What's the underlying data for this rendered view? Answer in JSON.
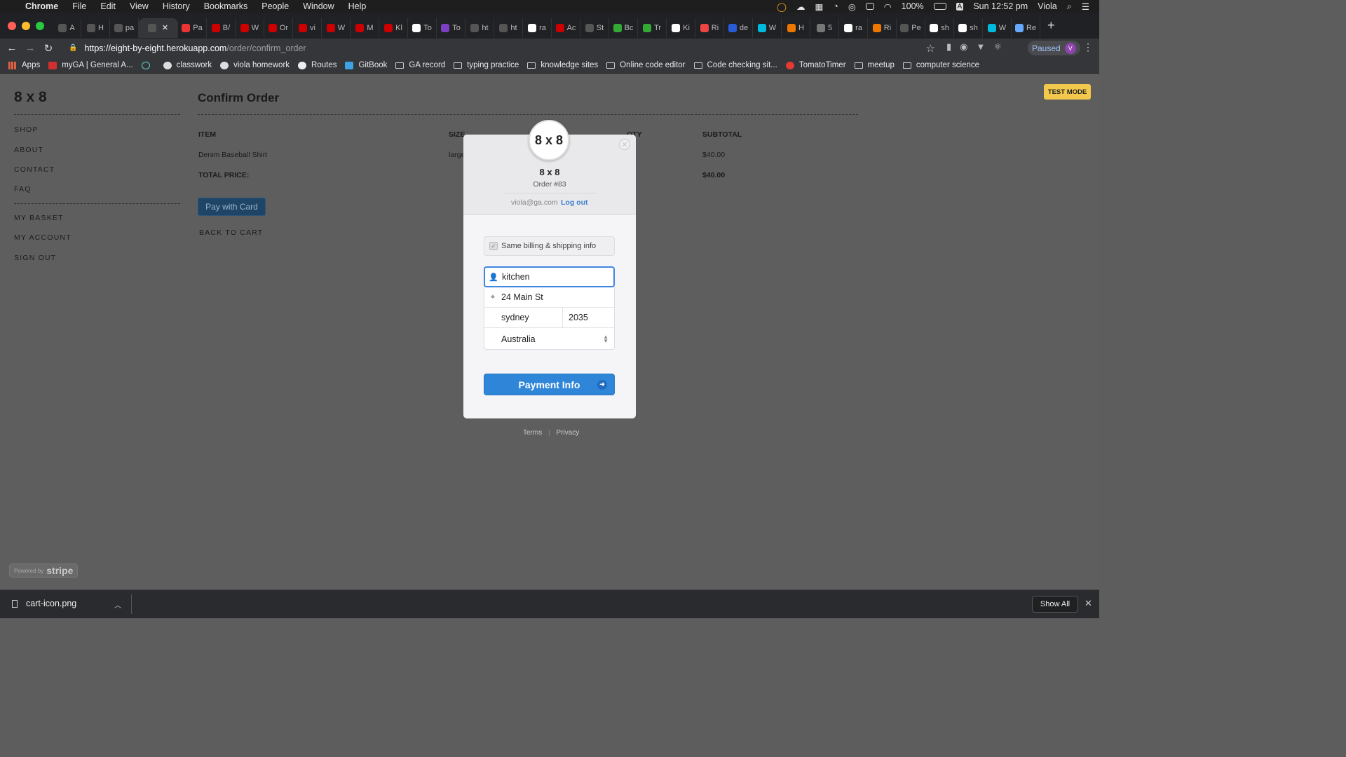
{
  "menubar": {
    "app": "Chrome",
    "items": [
      "File",
      "Edit",
      "View",
      "History",
      "Bookmarks",
      "People",
      "Window",
      "Help"
    ],
    "battery": "100%",
    "clock": "Sun 12:52 pm",
    "user": "Viola"
  },
  "tabs": [
    "A",
    "H",
    "pa",
    "",
    "Pa",
    "B/",
    "W",
    "Or",
    "vi",
    "W",
    "M",
    "Kl",
    "To",
    "To",
    "ht",
    "ht",
    "ra",
    "Ac",
    "St",
    "Bc",
    "Tr",
    "Ki",
    "Ri",
    "de",
    "W",
    "H",
    "5",
    "ra",
    "Ri",
    "Pe",
    "sh",
    "sh",
    "W",
    "Re"
  ],
  "toolbar": {
    "url_host": "https://eight-by-eight.herokuapp.com",
    "url_path": "/order/confirm_order",
    "paused_label": "Paused",
    "avatar": "V"
  },
  "bookmarks": [
    "Apps",
    "myGA | General A...",
    "",
    "classwork",
    "viola homework",
    "Routes",
    "GitBook",
    "GA record",
    "typing practice",
    "knowledge sites",
    "Online code editor",
    "Code checking sit...",
    "TomatoTimer",
    "meetup",
    "computer science"
  ],
  "site": {
    "brand": "8 x 8",
    "nav_main": [
      "SHOP",
      "ABOUT",
      "CONTACT",
      "FAQ"
    ],
    "nav_user": [
      "MY BASKET",
      "MY ACCOUNT",
      "SIGN OUT"
    ],
    "title": "Confirm Order",
    "columns": {
      "item": "ITEM",
      "size": "SIZE",
      "qty": "QTY",
      "subtotal": "SUBTOTAL"
    },
    "row": {
      "item": "Denim Baseball Shirt",
      "size": "large",
      "subtotal": "$40.00"
    },
    "total_label": "TOTAL PRICE:",
    "total_value": "$40.00",
    "pay_button": "Pay with Card",
    "back_link": "BACK TO CART",
    "test_mode": "TEST MODE",
    "powered_by": "Powered by",
    "powered_brand": "stripe"
  },
  "modal": {
    "logo": "8 x 8",
    "name": "8 x 8",
    "order": "Order #83",
    "email": "viola@ga.com",
    "logout": "Log out",
    "same_info_label": "Same billing & shipping info",
    "name_value": "kitchen",
    "address_value": "24 Main St",
    "city_value": "sydney",
    "zip_value": "2035",
    "country_value": "Australia",
    "submit_label": "Payment Info",
    "terms": "Terms",
    "privacy": "Privacy"
  },
  "downloads": {
    "file": "cart-icon.png",
    "show_all": "Show All"
  },
  "colors": {
    "accent": "#2f86d9",
    "overlay": "#5e5e5e",
    "test_mode": "#f2c94c"
  }
}
